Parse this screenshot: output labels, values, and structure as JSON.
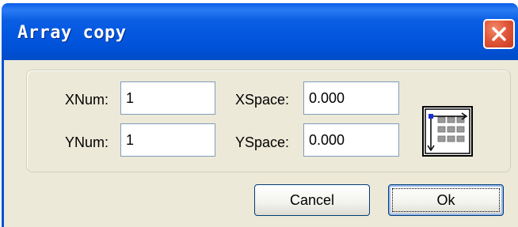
{
  "dialog": {
    "title": "Array copy",
    "close_icon": "close-icon",
    "fields": {
      "xnum": {
        "label": "XNum:",
        "value": "1"
      },
      "ynum": {
        "label": "YNum:",
        "value": "1"
      },
      "xspace": {
        "label": "XSpace:",
        "value": "0.000"
      },
      "yspace": {
        "label": "YSpace:",
        "value": "0.000"
      }
    },
    "array_icon": "array-grid-icon",
    "buttons": {
      "cancel": "Cancel",
      "ok": "Ok"
    }
  },
  "colors": {
    "titlebar": "#0054e3",
    "close": "#e2583a",
    "window_bg": "#ece9d8",
    "input_border": "#7f9db9"
  }
}
